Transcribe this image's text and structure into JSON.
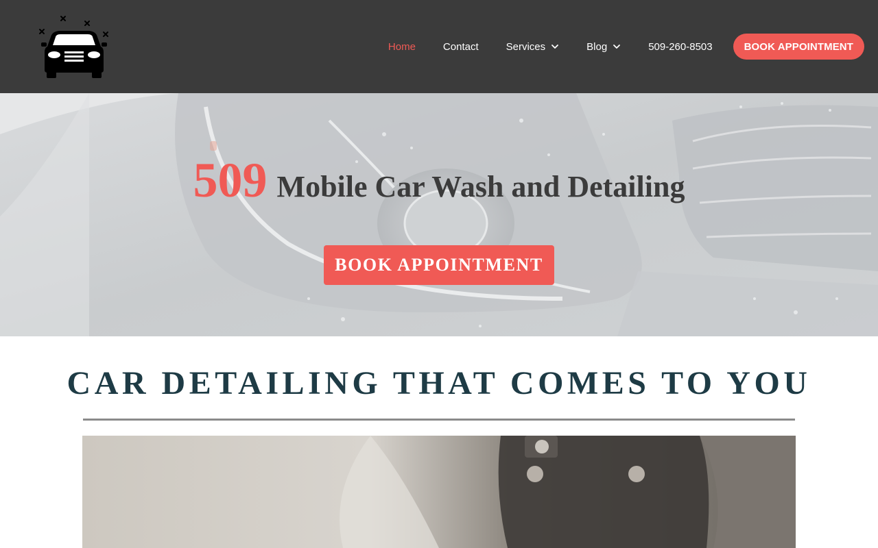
{
  "header": {
    "logo_name": "car-logo",
    "nav": [
      {
        "label": "Home",
        "active": true,
        "dropdown": false
      },
      {
        "label": "Contact",
        "active": false,
        "dropdown": false
      },
      {
        "label": "Services",
        "active": false,
        "dropdown": true
      },
      {
        "label": "Blog",
        "active": false,
        "dropdown": true
      },
      {
        "label": "509-260-8503",
        "active": false,
        "dropdown": false
      }
    ],
    "cta_label": "BOOK APPOINTMENT"
  },
  "hero": {
    "title_number": "509",
    "title_text": "Mobile Car Wash and Detailing",
    "button_label": "BOOK APPOINTMENT"
  },
  "section": {
    "heading": "CAR DETAILING THAT COMES TO YOU"
  },
  "colors": {
    "accent": "#f05a55",
    "header_bg": "#3b3b3b",
    "heading": "#1e3b45"
  },
  "icons": [
    "car-logo",
    "chevron-down-icon"
  ]
}
